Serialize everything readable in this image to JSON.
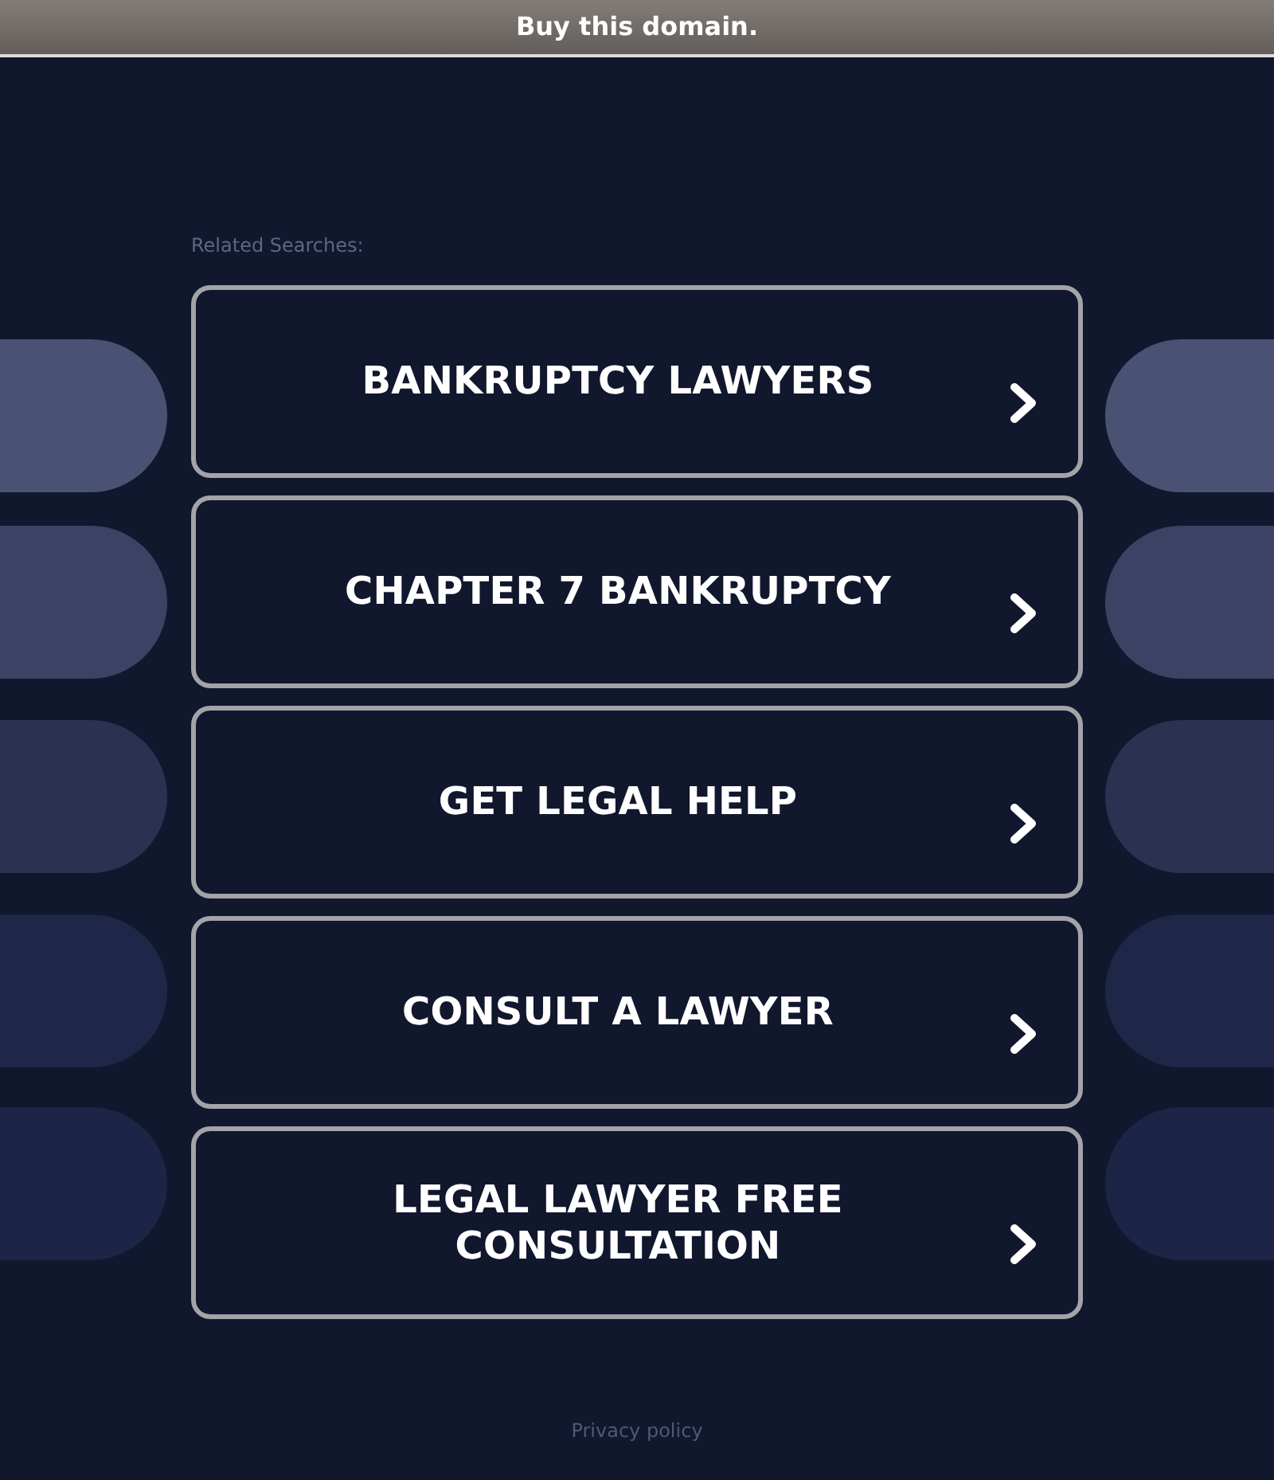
{
  "top_bar": {
    "link": "Buy this domain."
  },
  "related_searches": {
    "heading": "Related Searches:",
    "items": [
      "BANKRUPTCY LAWYERS",
      "CHAPTER 7 BANKRUPTCY",
      "GET LEGAL HELP",
      "CONSULT A LAWYER",
      "LEGAL LAWYER FREE CONSULTATION"
    ]
  },
  "footer": {
    "link": "Privacy policy"
  }
}
